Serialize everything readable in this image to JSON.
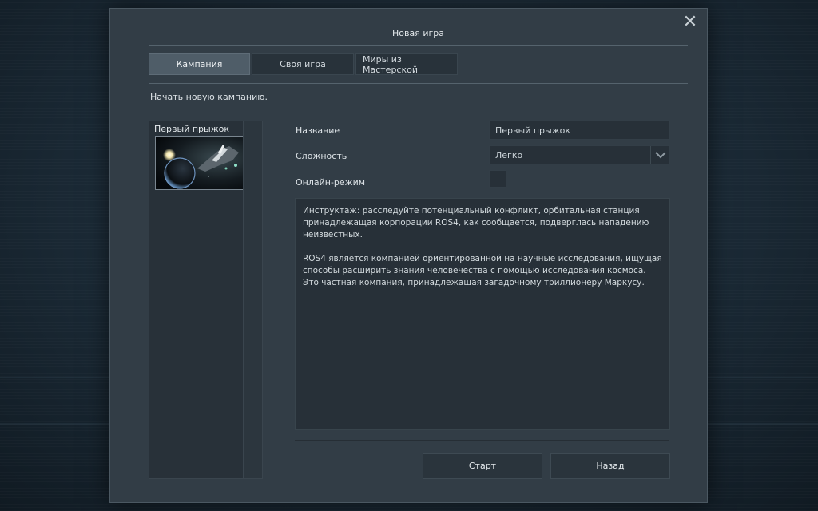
{
  "dialog": {
    "title": "Новая игра",
    "close_glyph": "✕",
    "tabs": [
      {
        "label": "Кампания",
        "active": true
      },
      {
        "label": "Своя игра",
        "active": false
      },
      {
        "label": "Миры из Мастерской",
        "active": false
      }
    ],
    "subtitle": "Начать новую кампанию."
  },
  "campaign_list": {
    "items": [
      {
        "name": "Первый прыжок"
      }
    ]
  },
  "form": {
    "name_label": "Название",
    "name_value": "Первый прыжок",
    "difficulty_label": "Сложность",
    "difficulty_value": "Легко",
    "online_label": "Онлайн-режим",
    "online_checked": false
  },
  "description": {
    "paragraphs": [
      "Инструктаж: расследуйте потенциальный конфликт, орбитальная станция принадлежащая корпорации ROS4, как сообщается, подверглась нападению неизвестных.",
      "ROS4 является компанией ориентированной на научные исследования, ищущая способы расширить знания человечества с помощью исследования космоса. Это частная компания, принадлежащая загадочному триллионеру Маркусу."
    ]
  },
  "buttons": {
    "start": "Старт",
    "back": "Назад"
  },
  "icons": {
    "close": "close-icon",
    "dropdown": "chevron-down-icon"
  },
  "colors": {
    "panel": "#323d46",
    "field": "#273038",
    "active_tab": "#4f5d68"
  }
}
